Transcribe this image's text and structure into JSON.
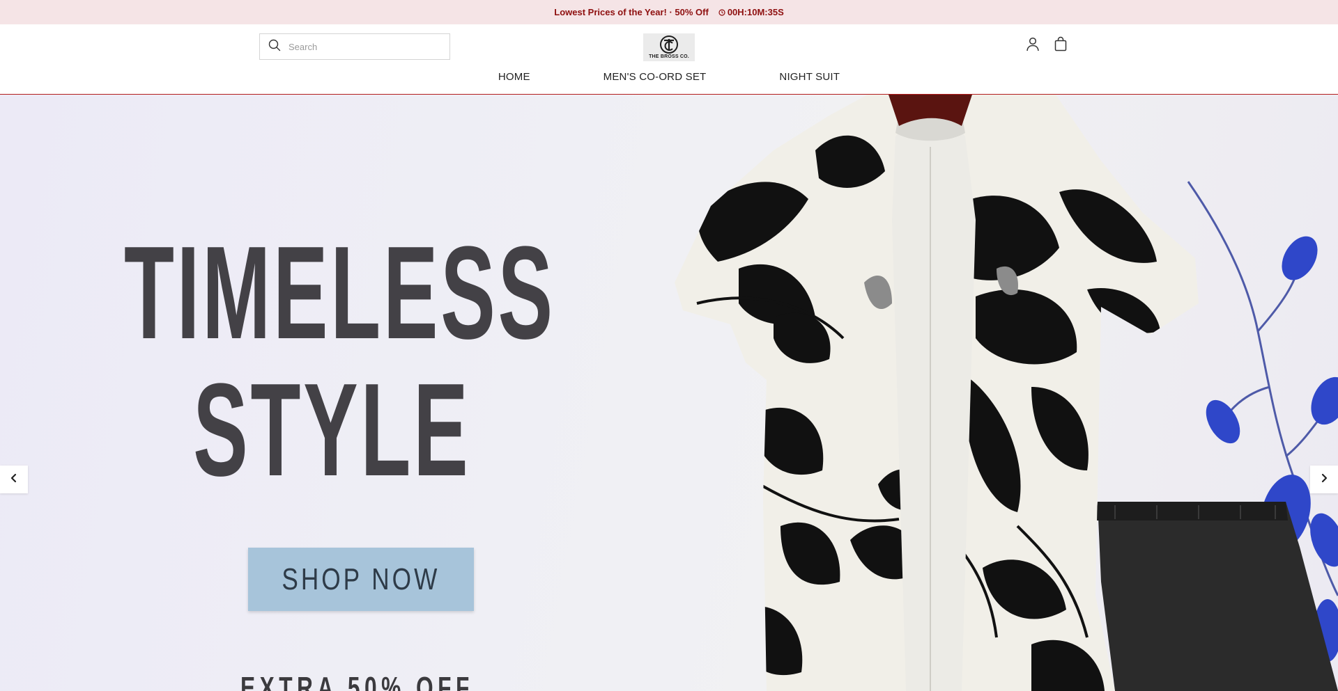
{
  "announcement": {
    "text": "Lowest Prices of the Year! · 50% Off",
    "timer": "00H:10M:35S",
    "color": "#8e0f0f"
  },
  "header": {
    "search_placeholder": "Search",
    "logo_text": "THE BROSS CO.",
    "nav": [
      "HOME",
      "MEN'S CO-ORD SET",
      "NIGHT SUIT"
    ]
  },
  "hero": {
    "title_line1": "TIMELESS",
    "title_line2": "STYLE",
    "cta": "SHOP NOW",
    "extra": "EXTRA 50% OFF"
  },
  "icons": {
    "search": "search-icon",
    "account": "user-icon",
    "cart": "shopping-bag-icon",
    "prev": "chevron-left-icon",
    "next": "chevron-right-icon",
    "timer": "clock-icon"
  }
}
